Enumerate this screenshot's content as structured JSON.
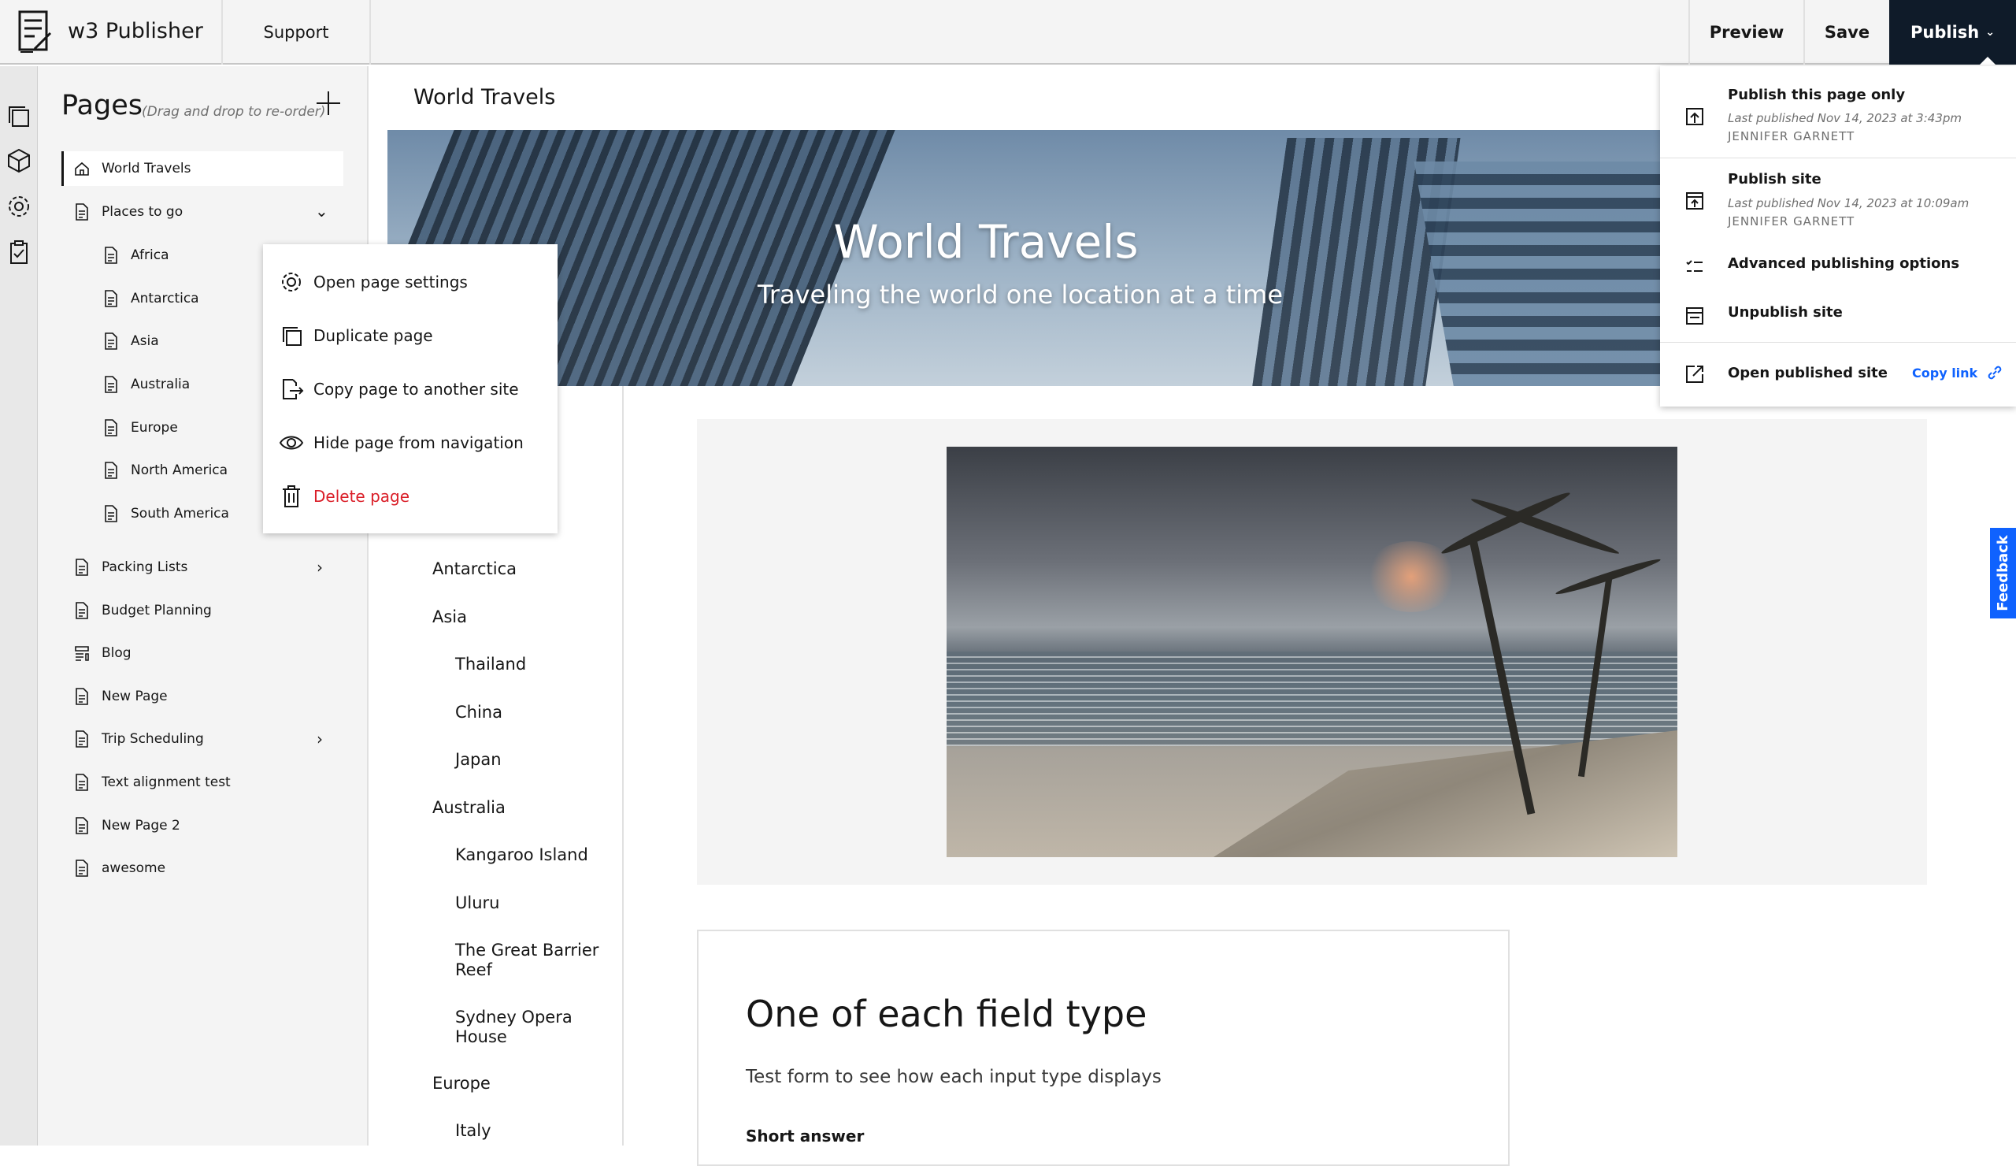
{
  "header": {
    "app_title": "w3 Publisher",
    "support_label": "Support",
    "preview_label": "Preview",
    "save_label": "Save",
    "publish_label": "Publish"
  },
  "pages_panel": {
    "title": "Pages",
    "hint": "(Drag and drop to re-order)",
    "items": [
      {
        "label": "World Travels",
        "icon": "home-icon"
      },
      {
        "label": "Places to go",
        "icon": "document-icon",
        "expanded": true
      },
      {
        "label": "Africa",
        "icon": "document-icon"
      },
      {
        "label": "Antarctica",
        "icon": "document-icon"
      },
      {
        "label": "Asia",
        "icon": "document-icon"
      },
      {
        "label": "Australia",
        "icon": "document-icon"
      },
      {
        "label": "Europe",
        "icon": "document-icon"
      },
      {
        "label": "North America",
        "icon": "document-icon"
      },
      {
        "label": "South America",
        "icon": "document-icon"
      },
      {
        "label": "Packing Lists",
        "icon": "document-icon",
        "expanded": false
      },
      {
        "label": "Budget Planning",
        "icon": "document-icon"
      },
      {
        "label": "Blog",
        "icon": "blog-icon"
      },
      {
        "label": "New Page",
        "icon": "document-icon"
      },
      {
        "label": "Trip Scheduling",
        "icon": "document-icon",
        "expanded": false
      },
      {
        "label": "Text alignment test",
        "icon": "document-icon"
      },
      {
        "label": "New Page 2",
        "icon": "document-icon"
      },
      {
        "label": "awesome",
        "icon": "document-icon"
      }
    ]
  },
  "context_menu": {
    "items": [
      {
        "label": "Open page settings",
        "icon": "gear-icon"
      },
      {
        "label": "Duplicate page",
        "icon": "copy-icon"
      },
      {
        "label": "Copy page to another site",
        "icon": "export-icon"
      },
      {
        "label": "Hide page from navigation",
        "icon": "eye-icon"
      },
      {
        "label": "Delete page",
        "icon": "trash-icon",
        "color": "#da1e28"
      }
    ]
  },
  "main": {
    "page_title": "World Travels",
    "hero_title": "World Travels",
    "hero_subtitle": "Traveling the world one location at a time",
    "site_nav": [
      {
        "label": "Antarctica"
      },
      {
        "label": "Asia"
      },
      {
        "label": "Thailand"
      },
      {
        "label": "China"
      },
      {
        "label": "Japan"
      },
      {
        "label": "Australia"
      },
      {
        "label": "Kangaroo Island"
      },
      {
        "label": "Uluru"
      },
      {
        "label": "The Great Barrier Reef"
      },
      {
        "label": "Sydney Opera House"
      },
      {
        "label": "Europe"
      },
      {
        "label": "Italy"
      }
    ],
    "form": {
      "title": "One of each field type",
      "description": "Test form to see how each input type displays",
      "first_label": "Short answer"
    }
  },
  "publish_menu": {
    "publish_page": {
      "label": "Publish this page only",
      "meta": "Last published Nov 14, 2023 at 3:43pm",
      "author": "JENNIFER GARNETT"
    },
    "publish_site": {
      "label": "Publish site",
      "meta": "Last published Nov 14, 2023 at 10:09am",
      "author": "JENNIFER GARNETT"
    },
    "advanced_label": "Advanced publishing options",
    "unpublish_label": "Unpublish site",
    "open_published_label": "Open published site",
    "copy_link_label": "Copy link"
  },
  "feedback_label": "Feedback",
  "colors": {
    "publish_bg": "#0f1b29",
    "danger": "#da1e28",
    "link": "#0f62fe",
    "panel_bg": "#f4f4f4"
  }
}
